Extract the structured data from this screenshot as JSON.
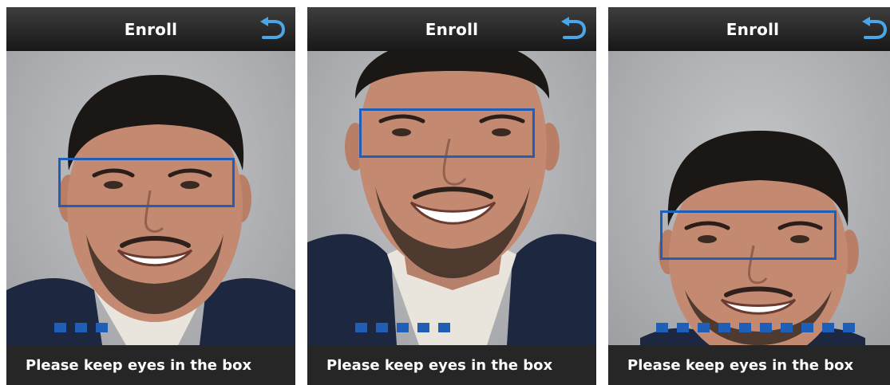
{
  "screens": [
    {
      "title": "Enroll",
      "back_icon": "back-arrow-icon",
      "hint": "Please keep eyes in the box",
      "progress": {
        "filled": 3
      }
    },
    {
      "title": "Enroll",
      "back_icon": "back-arrow-icon",
      "hint": "Please keep eyes in the box",
      "progress": {
        "filled": 5
      }
    },
    {
      "title": "Enroll",
      "back_icon": "back-arrow-icon",
      "hint": "Please keep eyes in the box",
      "progress": {
        "filled": 10
      }
    }
  ],
  "colors": {
    "accent": "#1f5fb8",
    "titlebar_top": "#3e3e3e",
    "titlebar_bottom": "#171717",
    "bottombar": "#262626",
    "background": "#b3b5b8"
  }
}
